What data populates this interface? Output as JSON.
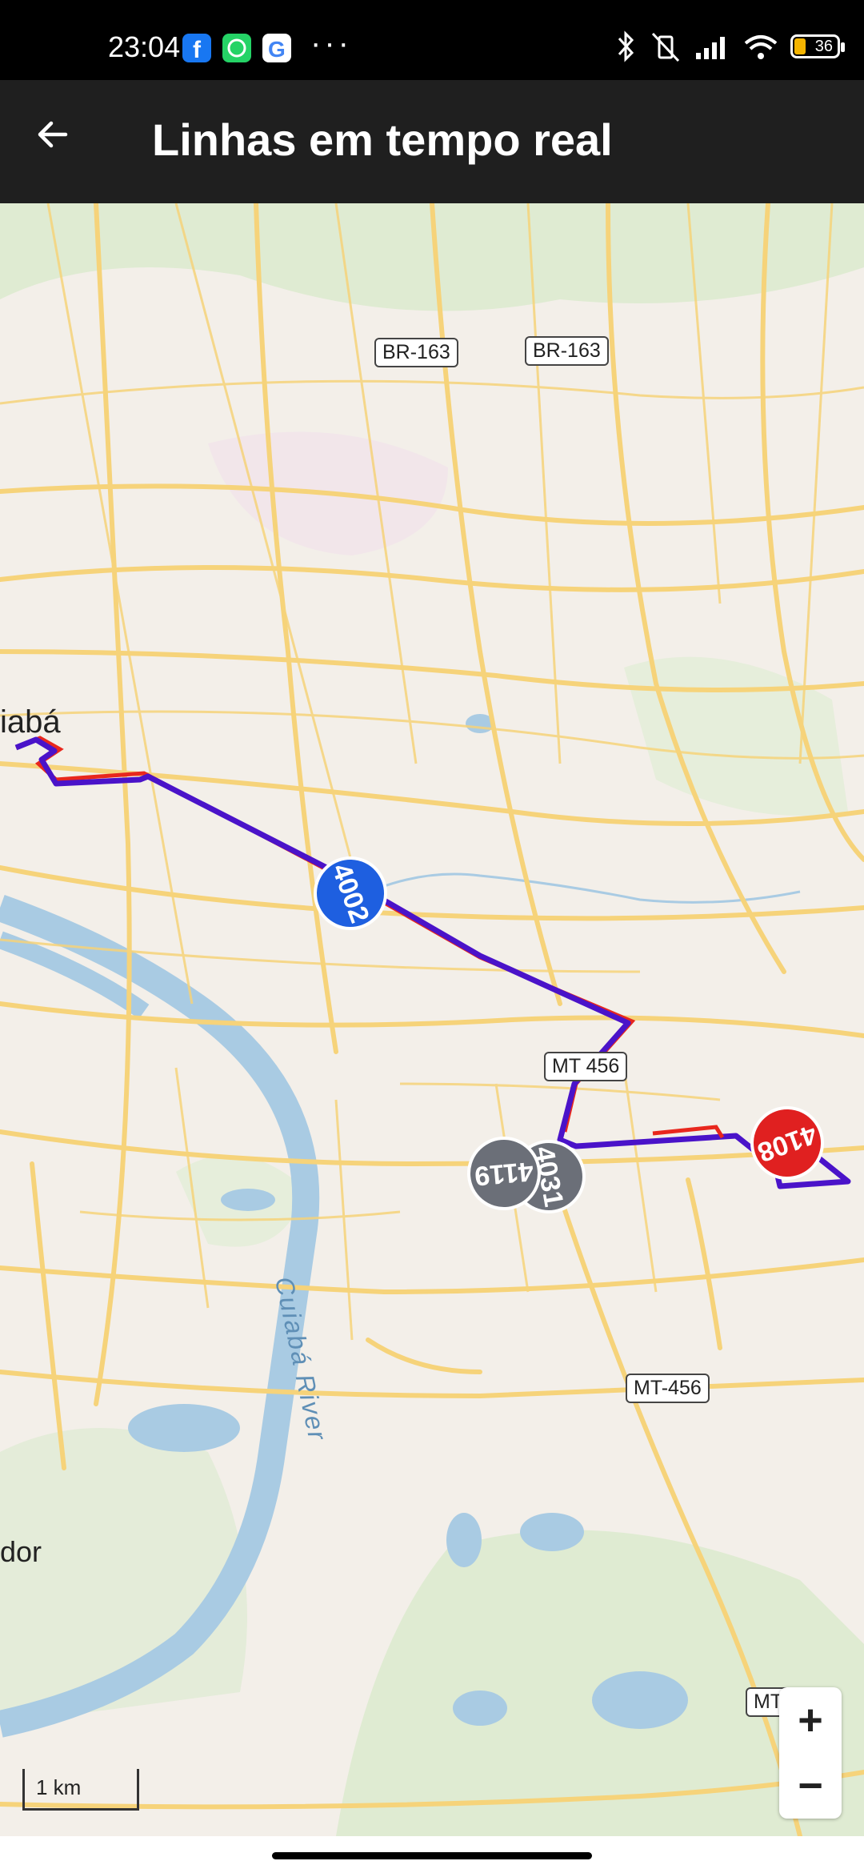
{
  "status_bar": {
    "time": "23:04",
    "notification_icons": [
      "facebook-icon",
      "whatsapp-icon",
      "google-icon"
    ],
    "more": "···",
    "battery": "36"
  },
  "app_bar": {
    "title": "Linhas em tempo real",
    "back_icon": "arrow-left-icon"
  },
  "map": {
    "road_labels": [
      "BR-163",
      "BR-163",
      "MT 456",
      "MT-456",
      "MT"
    ],
    "place_labels": [
      "iabá",
      "dor"
    ],
    "river_label": "Cuiabá River",
    "buses": [
      {
        "id": "4002",
        "color": "#1e5fe0"
      },
      {
        "id": "4119",
        "color": "#6b6f78"
      },
      {
        "id": "4031",
        "color": "#6b6f78"
      },
      {
        "id": "4108",
        "color": "#e02020"
      }
    ],
    "scale_label": "1 km",
    "zoom_in": "+",
    "zoom_out": "−"
  },
  "colors": {
    "route_primary": "#4a13c9",
    "route_secondary": "#e8271d",
    "road": "#f6d37a",
    "water": "#a9cbe3",
    "park": "#d9e8cc"
  }
}
